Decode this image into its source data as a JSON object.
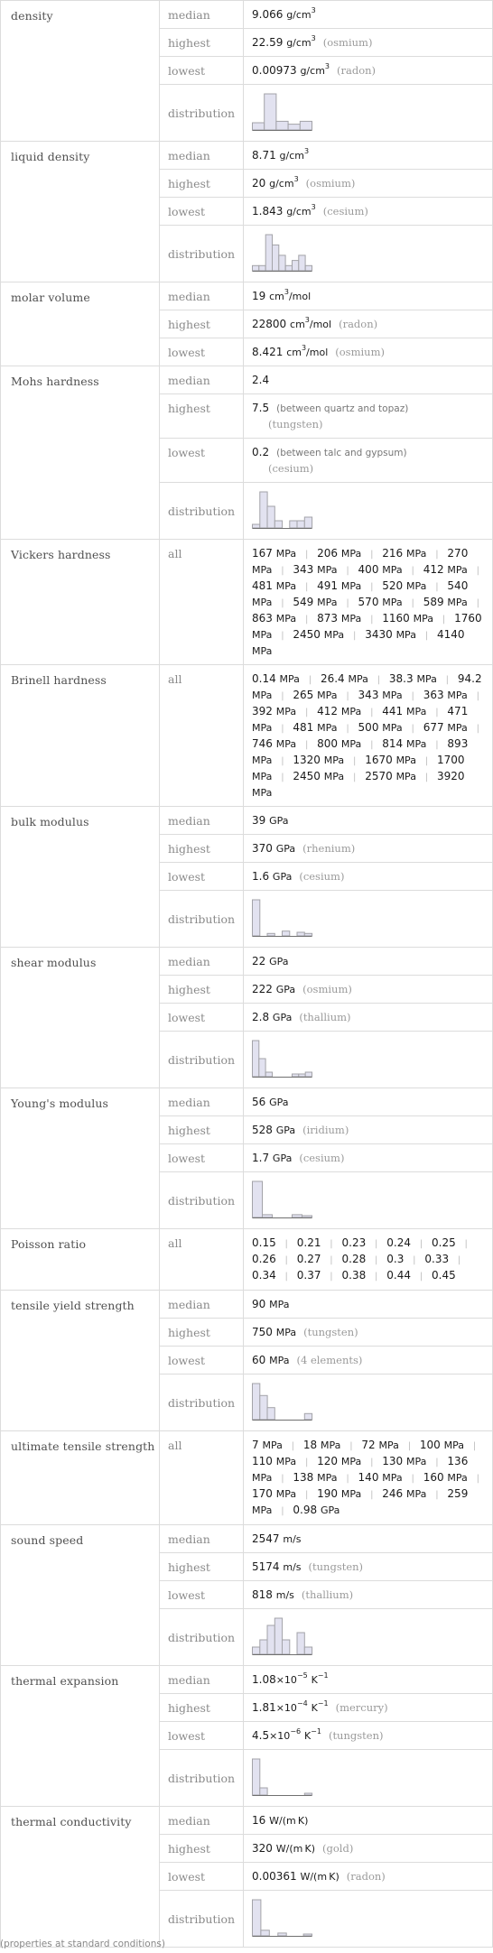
{
  "footnote": "(properties at standard conditions)",
  "labels": {
    "median": "median",
    "highest": "highest",
    "lowest": "lowest",
    "distribution": "distribution",
    "all": "all"
  },
  "properties": [
    {
      "name": "density",
      "type": "stats",
      "median": {
        "value": "9.066",
        "unit": "g/cm",
        "sup": "3"
      },
      "highest": {
        "value": "22.59",
        "unit": "g/cm",
        "sup": "3",
        "note": "(osmium)"
      },
      "lowest": {
        "value": "0.00973",
        "unit": "g/cm",
        "sup": "3",
        "note": "(radon)"
      },
      "distribution": [
        1,
        5,
        1.2,
        0.8,
        1.2
      ]
    },
    {
      "name": "liquid density",
      "type": "stats",
      "median": {
        "value": "8.71",
        "unit": "g/cm",
        "sup": "3"
      },
      "highest": {
        "value": "20",
        "unit": "g/cm",
        "sup": "3",
        "note": "(osmium)"
      },
      "lowest": {
        "value": "1.843",
        "unit": "g/cm",
        "sup": "3",
        "note": "(cesium)"
      },
      "distribution": [
        1,
        1,
        7,
        5,
        3,
        1,
        2,
        3,
        1
      ]
    },
    {
      "name": "molar volume",
      "type": "stats_nodist",
      "median": {
        "value": "19",
        "unit": "cm",
        "sup": "3",
        "unit2": "/mol"
      },
      "highest": {
        "value": "22800",
        "unit": "cm",
        "sup": "3",
        "unit2": "/mol",
        "note": "(radon)"
      },
      "lowest": {
        "value": "8.421",
        "unit": "cm",
        "sup": "3",
        "unit2": "/mol",
        "note": "(osmium)"
      }
    },
    {
      "name": "Mohs hardness",
      "type": "stats",
      "median": {
        "value": "2.4"
      },
      "highest": {
        "value": "7.5",
        "desc": "(between quartz and topaz)",
        "note": "(tungsten)"
      },
      "lowest": {
        "value": "0.2",
        "desc": "(between talc and gypsum)",
        "note": "(cesium)"
      },
      "distribution": [
        1,
        10,
        6,
        2,
        0,
        2,
        2,
        3
      ]
    },
    {
      "name": "Vickers hardness",
      "type": "all",
      "unit": "MPa",
      "values": [
        "167",
        "206",
        "216",
        "270",
        "343",
        "400",
        "412",
        "481",
        "491",
        "520",
        "540",
        "549",
        "570",
        "589",
        "863",
        "873",
        "1160",
        "1760",
        "2450",
        "3430",
        "4140"
      ]
    },
    {
      "name": "Brinell hardness",
      "type": "all",
      "unit": "MPa",
      "values": [
        "0.14",
        "26.4",
        "38.3",
        "94.2",
        "265",
        "343",
        "363",
        "392",
        "412",
        "441",
        "471",
        "481",
        "500",
        "677",
        "746",
        "800",
        "814",
        "893",
        "1320",
        "1670",
        "1700",
        "2450",
        "2570",
        "3920"
      ]
    },
    {
      "name": "bulk modulus",
      "type": "stats",
      "median": {
        "value": "39",
        "unit": "GPa"
      },
      "highest": {
        "value": "370",
        "unit": "GPa",
        "note": "(rhenium)"
      },
      "lowest": {
        "value": "1.6",
        "unit": "GPa",
        "note": "(cesium)"
      },
      "distribution": [
        15,
        0,
        1,
        0,
        2,
        0,
        1.5,
        1
      ]
    },
    {
      "name": "shear modulus",
      "type": "stats",
      "median": {
        "value": "22",
        "unit": "GPa"
      },
      "highest": {
        "value": "222",
        "unit": "GPa",
        "note": "(osmium)"
      },
      "lowest": {
        "value": "2.8",
        "unit": "GPa",
        "note": "(thallium)"
      },
      "distribution": [
        8,
        4,
        1,
        0,
        0,
        0,
        0.6,
        0.6,
        1
      ]
    },
    {
      "name": "Young's modulus",
      "type": "stats",
      "median": {
        "value": "56",
        "unit": "GPa"
      },
      "highest": {
        "value": "528",
        "unit": "GPa",
        "note": "(iridium)"
      },
      "lowest": {
        "value": "1.7",
        "unit": "GPa",
        "note": "(cesium)"
      },
      "distribution": [
        13,
        1,
        0,
        0,
        1,
        0.6
      ]
    },
    {
      "name": "Poisson ratio",
      "type": "all",
      "unit": "",
      "values": [
        "0.15",
        "0.21",
        "0.23",
        "0.24",
        "0.25",
        "0.26",
        "0.27",
        "0.28",
        "0.3",
        "0.33",
        "0.34",
        "0.37",
        "0.38",
        "0.44",
        "0.45"
      ]
    },
    {
      "name": "tensile yield strength",
      "type": "stats",
      "median": {
        "value": "90",
        "unit": "MPa"
      },
      "highest": {
        "value": "750",
        "unit": "MPa",
        "note": "(tungsten)"
      },
      "lowest": {
        "value": "60",
        "unit": "MPa",
        "note": "(4 elements)"
      },
      "distribution": [
        6,
        4,
        2,
        0,
        0,
        0,
        0,
        1
      ]
    },
    {
      "name": "ultimate tensile strength",
      "type": "all",
      "unit": "MPa",
      "values": [
        "7",
        "18",
        "72",
        "100",
        "110",
        "120",
        "130",
        "136",
        "138",
        "140",
        "160",
        "170",
        "190",
        "246",
        "259"
      ],
      "extra": {
        "value": "0.98",
        "unit": "GPa"
      }
    },
    {
      "name": "sound speed",
      "type": "stats",
      "median": {
        "value": "2547",
        "unit": "m/s"
      },
      "highest": {
        "value": "5174",
        "unit": "m/s",
        "note": "(tungsten)"
      },
      "lowest": {
        "value": "818",
        "unit": "m/s",
        "note": "(thallium)"
      },
      "distribution": [
        1,
        2,
        4,
        5,
        2,
        0,
        3,
        1
      ]
    },
    {
      "name": "thermal expansion",
      "type": "stats",
      "median": {
        "value": "1.08",
        "times": "×10",
        "exp": "−5",
        "unit": "K",
        "sup": "−1"
      },
      "highest": {
        "value": "1.81",
        "times": "×10",
        "exp": "−4",
        "unit": "K",
        "sup": "−1",
        "note": "(mercury)"
      },
      "lowest": {
        "value": "4.5",
        "times": "×10",
        "exp": "−6",
        "unit": "K",
        "sup": "−1",
        "note": "(tungsten)"
      },
      "distribution": [
        10,
        2,
        0,
        0,
        0,
        0,
        0,
        0.5
      ]
    },
    {
      "name": "thermal conductivity",
      "type": "stats",
      "median": {
        "value": "16",
        "unit": "W/(m K)"
      },
      "highest": {
        "value": "320",
        "unit": "W/(m K)",
        "note": "(gold)"
      },
      "lowest": {
        "value": "0.00361",
        "unit": "W/(m K)",
        "note": "(radon)"
      },
      "distribution": [
        13,
        2,
        0,
        1,
        0,
        0,
        0.6
      ]
    }
  ],
  "chart_data": [
    {
      "type": "bar",
      "title": "density distribution",
      "values": [
        1,
        5,
        1.2,
        0.8,
        1.2
      ]
    },
    {
      "type": "bar",
      "title": "liquid density distribution",
      "values": [
        1,
        1,
        7,
        5,
        3,
        1,
        2,
        3,
        1
      ]
    },
    {
      "type": "bar",
      "title": "Mohs hardness distribution",
      "values": [
        1,
        10,
        6,
        2,
        0,
        2,
        2,
        3
      ]
    },
    {
      "type": "bar",
      "title": "bulk modulus distribution",
      "values": [
        15,
        0,
        1,
        0,
        2,
        0,
        1.5,
        1
      ]
    },
    {
      "type": "bar",
      "title": "shear modulus distribution",
      "values": [
        8,
        4,
        1,
        0,
        0,
        0,
        0.6,
        0.6,
        1
      ]
    },
    {
      "type": "bar",
      "title": "Young's modulus distribution",
      "values": [
        13,
        1,
        0,
        0,
        1,
        0.6
      ]
    },
    {
      "type": "bar",
      "title": "tensile yield strength distribution",
      "values": [
        6,
        4,
        2,
        0,
        0,
        0,
        0,
        1
      ]
    },
    {
      "type": "bar",
      "title": "sound speed distribution",
      "values": [
        1,
        2,
        4,
        5,
        2,
        0,
        3,
        1
      ]
    },
    {
      "type": "bar",
      "title": "thermal expansion distribution",
      "values": [
        10,
        2,
        0,
        0,
        0,
        0,
        0,
        0.5
      ]
    },
    {
      "type": "bar",
      "title": "thermal conductivity distribution",
      "values": [
        13,
        2,
        0,
        1,
        0,
        0,
        0.6
      ]
    }
  ]
}
